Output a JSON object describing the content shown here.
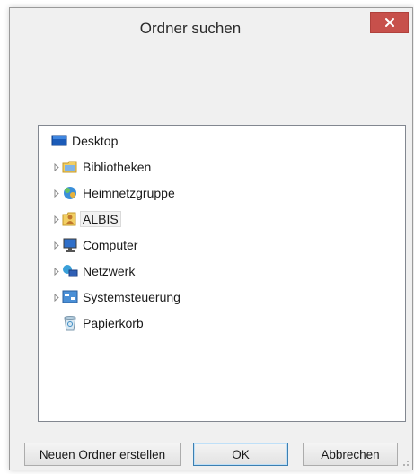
{
  "dialog": {
    "title": "Ordner suchen",
    "close_label": "×"
  },
  "tree": {
    "items": [
      {
        "label": "Desktop",
        "icon": "desktop-icon",
        "has_children": false
      },
      {
        "label": "Bibliotheken",
        "icon": "libraries-icon",
        "has_children": true
      },
      {
        "label": "Heimnetzgruppe",
        "icon": "homegroup-icon",
        "has_children": true
      },
      {
        "label": "ALBIS",
        "icon": "user-folder-icon",
        "has_children": true,
        "selected": true
      },
      {
        "label": "Computer",
        "icon": "computer-icon",
        "has_children": true
      },
      {
        "label": "Netzwerk",
        "icon": "network-icon",
        "has_children": true
      },
      {
        "label": "Systemsteuerung",
        "icon": "control-panel-icon",
        "has_children": true
      },
      {
        "label": "Papierkorb",
        "icon": "recycle-bin-icon",
        "has_children": false
      }
    ]
  },
  "buttons": {
    "new_folder": "Neuen Ordner erstellen",
    "ok": "OK",
    "cancel": "Abbrechen"
  },
  "colors": {
    "close_button": "#c7504b",
    "dialog_background": "#f0f0f0",
    "default_button_border": "#3c7fb1"
  }
}
